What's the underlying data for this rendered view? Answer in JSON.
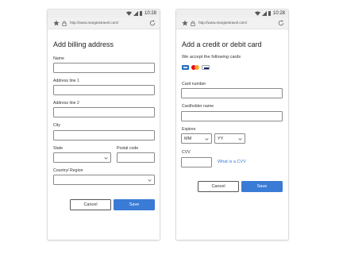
{
  "status_bar": {
    "time": "10:28"
  },
  "browser": {
    "url": "http://www.margiestravel.com/"
  },
  "billing": {
    "title": "Add billing address",
    "labels": {
      "name": "Name",
      "address1": "Address line 1",
      "address2": "Address line 2",
      "city": "City",
      "state": "State",
      "postal": "Postal code",
      "country": "Country/ Region"
    },
    "buttons": {
      "cancel": "Cancel",
      "save": "Save"
    }
  },
  "card": {
    "title": "Add a credit or debit card",
    "subtitle": "We accept the following cards",
    "accepted_cards": [
      "amex-icon",
      "mastercard-icon",
      "visa-icon"
    ],
    "labels": {
      "number": "Card number",
      "holder": "Cardholder name",
      "expires": "Expires",
      "cvv": "CVV"
    },
    "expiry_month": "MM",
    "expiry_year": "YY",
    "cvv_link": "What is a CVV",
    "buttons": {
      "cancel": "Cancel",
      "save": "Save"
    }
  },
  "colors": {
    "accent": "#3a7bd5",
    "chrome": "#f1f1f1"
  }
}
